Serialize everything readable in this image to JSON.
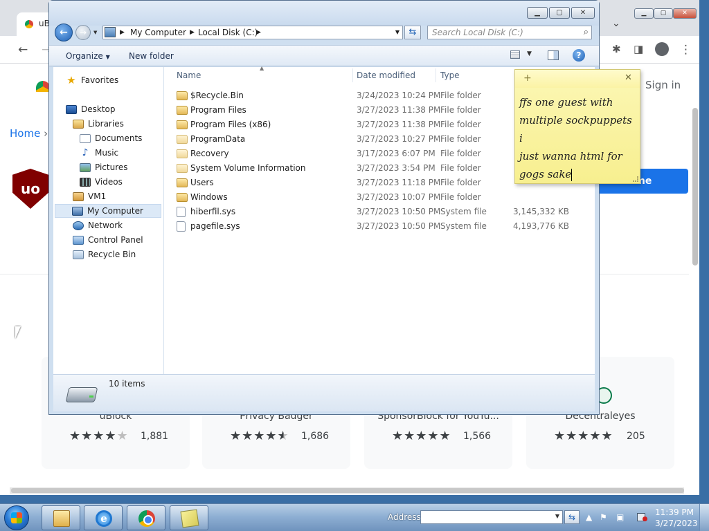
{
  "chrome": {
    "tab_title": "uB",
    "signin": "Sign in",
    "breadcrumb_home": "Home",
    "breadcrumb_sep": "›",
    "ub_logo": "uo",
    "add_button": "Add to Chrome",
    "add_button_visible": "o Chrome",
    "cards": [
      {
        "name": "uBlock",
        "stars": 4,
        "count": "1,881"
      },
      {
        "name": "Privacy Badger",
        "stars": 4.5,
        "count": "1,686"
      },
      {
        "name": "SponsorBlock for YouTu...",
        "stars": 5,
        "count": "1,566"
      },
      {
        "name": "Decentraleyes",
        "stars": 5,
        "count": "205"
      }
    ]
  },
  "explorer": {
    "address": {
      "root": "My Computer",
      "current": "Local Disk (C:)"
    },
    "search_placeholder": "Search Local Disk (C:)",
    "toolbar": {
      "organize": "Organize",
      "new_folder": "New folder"
    },
    "nav": [
      {
        "id": "favorites",
        "label": "Favorites",
        "icon": "star-icon"
      },
      {
        "id": "desktop",
        "label": "Desktop",
        "icon": "desktop-icon"
      },
      {
        "id": "libraries",
        "label": "Libraries",
        "icon": "libraries-icon"
      },
      {
        "id": "documents",
        "label": "Documents",
        "icon": "documents-icon"
      },
      {
        "id": "music",
        "label": "Music",
        "icon": "music-icon"
      },
      {
        "id": "pictures",
        "label": "Pictures",
        "icon": "pictures-icon"
      },
      {
        "id": "videos",
        "label": "Videos",
        "icon": "videos-icon"
      },
      {
        "id": "vm1",
        "label": "VM1",
        "icon": "user-folder-icon"
      },
      {
        "id": "my-computer",
        "label": "My Computer",
        "icon": "computer-icon",
        "selected": true
      },
      {
        "id": "network",
        "label": "Network",
        "icon": "network-icon"
      },
      {
        "id": "control-panel",
        "label": "Control Panel",
        "icon": "control-panel-icon"
      },
      {
        "id": "recycle-bin",
        "label": "Recycle Bin",
        "icon": "recycle-bin-icon"
      }
    ],
    "columns": {
      "name": "Name",
      "date": "Date modified",
      "type": "Type"
    },
    "files": [
      {
        "name": "$Recycle.Bin",
        "date": "3/24/2023 10:24 PM",
        "type": "File folder",
        "size": "",
        "icon": "locked-folder-icon"
      },
      {
        "name": "Program Files",
        "date": "3/27/2023 11:38 PM",
        "type": "File folder",
        "size": "",
        "icon": "folder-icon"
      },
      {
        "name": "Program Files (x86)",
        "date": "3/27/2023 11:38 PM",
        "type": "File folder",
        "size": "",
        "icon": "folder-icon"
      },
      {
        "name": "ProgramData",
        "date": "3/27/2023 10:27 PM",
        "type": "File folder",
        "size": "",
        "icon": "hidden-folder-icon"
      },
      {
        "name": "Recovery",
        "date": "3/17/2023 6:07 PM",
        "type": "File folder",
        "size": "",
        "icon": "hidden-folder-icon"
      },
      {
        "name": "System Volume Information",
        "date": "3/27/2023 3:54 PM",
        "type": "File folder",
        "size": "",
        "icon": "hidden-folder-icon"
      },
      {
        "name": "Users",
        "date": "3/27/2023 11:18 PM",
        "type": "File folder",
        "size": "",
        "icon": "folder-icon"
      },
      {
        "name": "Windows",
        "date": "3/27/2023 10:07 PM",
        "type": "File folder",
        "size": "",
        "icon": "folder-icon"
      },
      {
        "name": "hiberfil.sys",
        "date": "3/27/2023 10:50 PM",
        "type": "System file",
        "size": "3,145,332 KB",
        "icon": "system-file-icon"
      },
      {
        "name": "pagefile.sys",
        "date": "3/27/2023 10:50 PM",
        "type": "System file",
        "size": "4,193,776 KB",
        "icon": "system-file-icon"
      }
    ],
    "item_count": "10 items"
  },
  "sticky": {
    "line1": "ffs one guest with",
    "line2": "multiple sockpuppets i",
    "line3": "just wanna html for",
    "line4": "gogs sake"
  },
  "taskbar": {
    "address_label": "Address",
    "time": "11:39 PM",
    "date": "3/27/2023"
  },
  "colors": {
    "chrome_accent": "#1a73e8",
    "ublock_red": "#800000",
    "sticky_yellow": "#f9f29a",
    "taskbar_blue": "#8fb0d4"
  }
}
